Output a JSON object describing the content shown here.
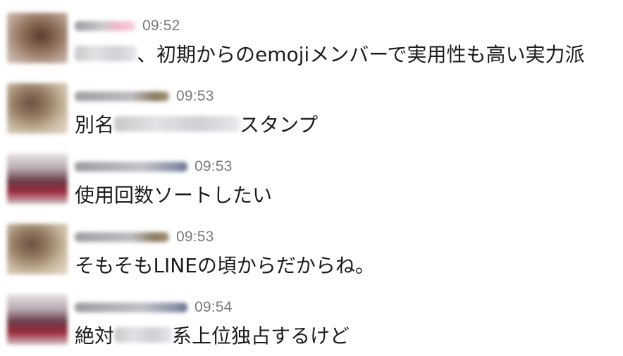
{
  "messages": [
    {
      "avatar": "user-avatar-blurred",
      "time": "09:52",
      "text_before": "",
      "text_after": "、初期からのemojiメンバーで実用性も高い実力派"
    },
    {
      "avatar": "user-avatar-blurred",
      "time": "09:53",
      "text_before": "別名",
      "text_after": "スタンプ"
    },
    {
      "avatar": "user-avatar-blurred",
      "time": "09:53",
      "text_before": "使用回数ソートしたい",
      "text_after": ""
    },
    {
      "avatar": "user-avatar-blurred",
      "time": "09:53",
      "text_before": "そもそもLINEの頃からだからね。",
      "text_after": ""
    },
    {
      "avatar": "user-avatar-blurred",
      "time": "09:54",
      "text_before": "絶対",
      "text_after": "系上位独占するけど"
    }
  ]
}
